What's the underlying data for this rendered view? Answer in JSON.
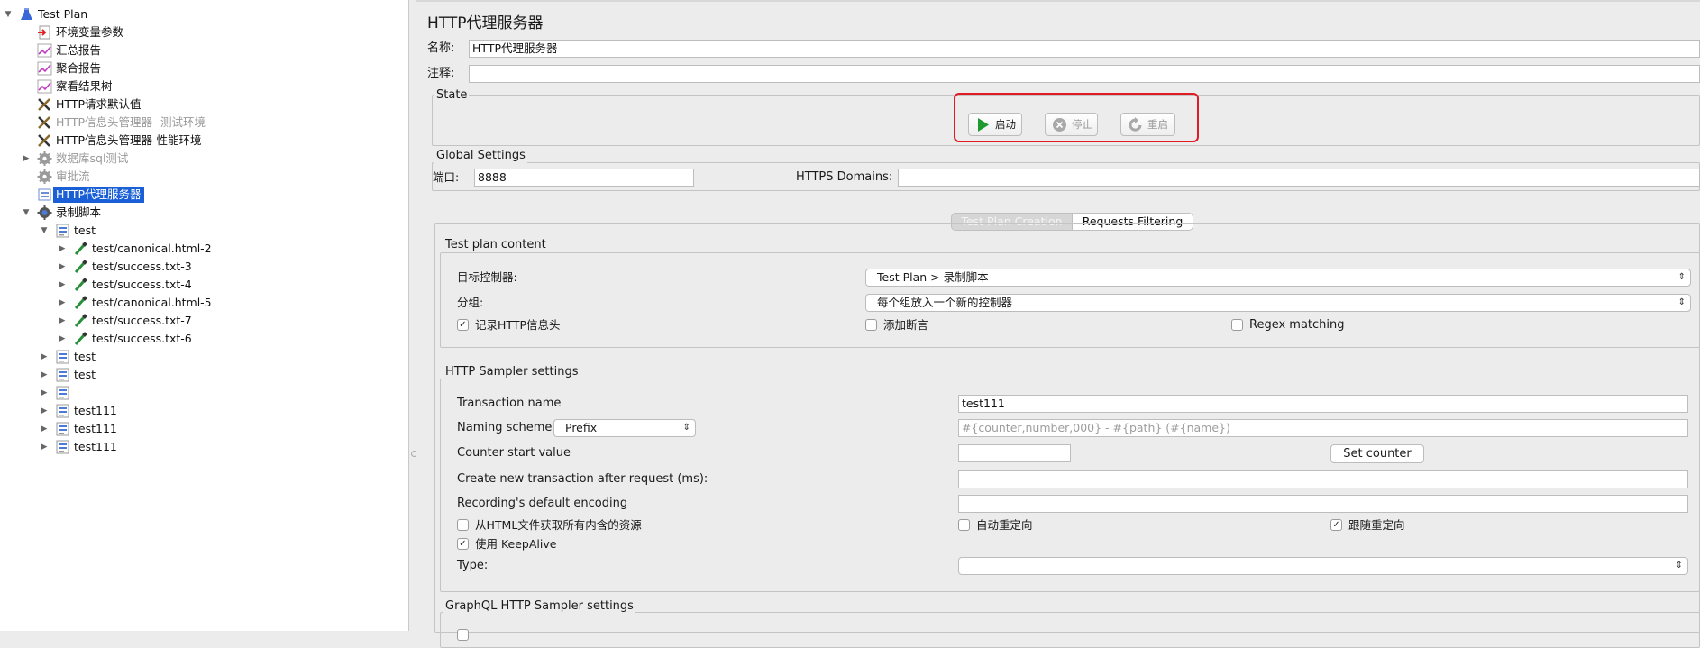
{
  "tree": {
    "items": [
      {
        "label": "Test Plan",
        "icon": "flask-icon",
        "arrow": "expanded"
      },
      {
        "label": "环境变量参数",
        "icon": "variables-icon"
      },
      {
        "label": "汇总报告",
        "icon": "graph-icon"
      },
      {
        "label": "聚合报告",
        "icon": "graph-icon"
      },
      {
        "label": "察看结果树",
        "icon": "graph-icon"
      },
      {
        "label": "HTTP请求默认值",
        "icon": "wrench-icon"
      },
      {
        "label": "HTTP信息头管理器--测试环境",
        "icon": "wrench-icon",
        "disabled": true
      },
      {
        "label": "HTTP信息头管理器-性能环境",
        "icon": "wrench-icon"
      },
      {
        "label": "数据库sql测试",
        "icon": "gear-icon",
        "arrow": "collapsed",
        "disabled": true
      },
      {
        "label": "审批流",
        "icon": "gear-icon",
        "disabled": true
      },
      {
        "label": "HTTP代理服务器",
        "icon": "proxy-icon",
        "selected": true
      },
      {
        "label": "录制脚本",
        "icon": "recorder-gear-icon",
        "arrow": "expanded"
      },
      {
        "label": "test",
        "icon": "controller-icon",
        "arrow": "expanded"
      },
      {
        "label": "test/canonical.html-2",
        "icon": "sampler-pipette-icon",
        "arrow": "collapsed"
      },
      {
        "label": "test/success.txt-3",
        "icon": "sampler-pipette-icon",
        "arrow": "collapsed"
      },
      {
        "label": "test/success.txt-4",
        "icon": "sampler-pipette-icon",
        "arrow": "collapsed"
      },
      {
        "label": "test/canonical.html-5",
        "icon": "sampler-pipette-icon",
        "arrow": "collapsed"
      },
      {
        "label": "test/success.txt-7",
        "icon": "sampler-pipette-icon",
        "arrow": "collapsed"
      },
      {
        "label": "test/success.txt-6",
        "icon": "sampler-pipette-icon",
        "arrow": "collapsed"
      },
      {
        "label": "test",
        "icon": "controller-icon",
        "arrow": "collapsed"
      },
      {
        "label": "test",
        "icon": "controller-icon",
        "arrow": "collapsed"
      },
      {
        "label": "",
        "icon": "controller-icon",
        "arrow": "collapsed"
      },
      {
        "label": "test111",
        "icon": "controller-icon",
        "arrow": "collapsed"
      },
      {
        "label": "test111",
        "icon": "controller-icon",
        "arrow": "collapsed"
      },
      {
        "label": "test111",
        "icon": "controller-icon",
        "arrow": "collapsed"
      }
    ]
  },
  "panel": {
    "title": "HTTP代理服务器",
    "name_label": "名称:",
    "name_value": "HTTP代理服务器",
    "comment_label": "注释:",
    "comment_value": "",
    "state": {
      "title": "State",
      "start": "启动",
      "stop": "停止",
      "restart": "重启",
      "highlight_color": "#e01b24"
    },
    "global": {
      "title": "Global Settings",
      "port_label": "端口:",
      "port_value": "8888",
      "https_label": "HTTPS Domains:",
      "https_value": ""
    },
    "tabs": [
      "Test Plan Creation",
      "Requests Filtering"
    ],
    "test_plan_content": {
      "title": "Test plan content",
      "target_label": "目标控制器:",
      "target_value": "Test Plan > 录制脚本",
      "grouping_label": "分组:",
      "grouping_value": "每个组放入一个新的控制器",
      "record_headers": {
        "label": "记录HTTP信息头",
        "checked": true
      },
      "add_assertions": {
        "label": "添加断言",
        "checked": false
      },
      "regex_matching": {
        "label": "Regex matching",
        "checked": false
      }
    },
    "sampler": {
      "title": "HTTP Sampler settings",
      "transaction_label": "Transaction name",
      "transaction_value": "test111",
      "naming_label": "Naming scheme",
      "naming_value": "Prefix",
      "naming_placeholder": "#{counter,number,000} - #{path} (#{name})",
      "counter_label": "Counter start value",
      "counter_value": "",
      "set_counter": "Set counter",
      "new_tx_label": "Create new transaction after request (ms):",
      "new_tx_value": "",
      "encoding_label": "Recording's default encoding",
      "encoding_value": "",
      "retrieve_resources": {
        "label": "从HTML文件获取所有内含的资源",
        "checked": false
      },
      "auto_redirect": {
        "label": "自动重定向",
        "checked": false
      },
      "follow_redirect": {
        "label": "跟随重定向",
        "checked": true
      },
      "keepalive": {
        "label": "使用 KeepAlive",
        "checked": true
      },
      "type_label": "Type:",
      "type_value": ""
    },
    "graphql": {
      "title": "GraphQL HTTP Sampler settings"
    }
  }
}
